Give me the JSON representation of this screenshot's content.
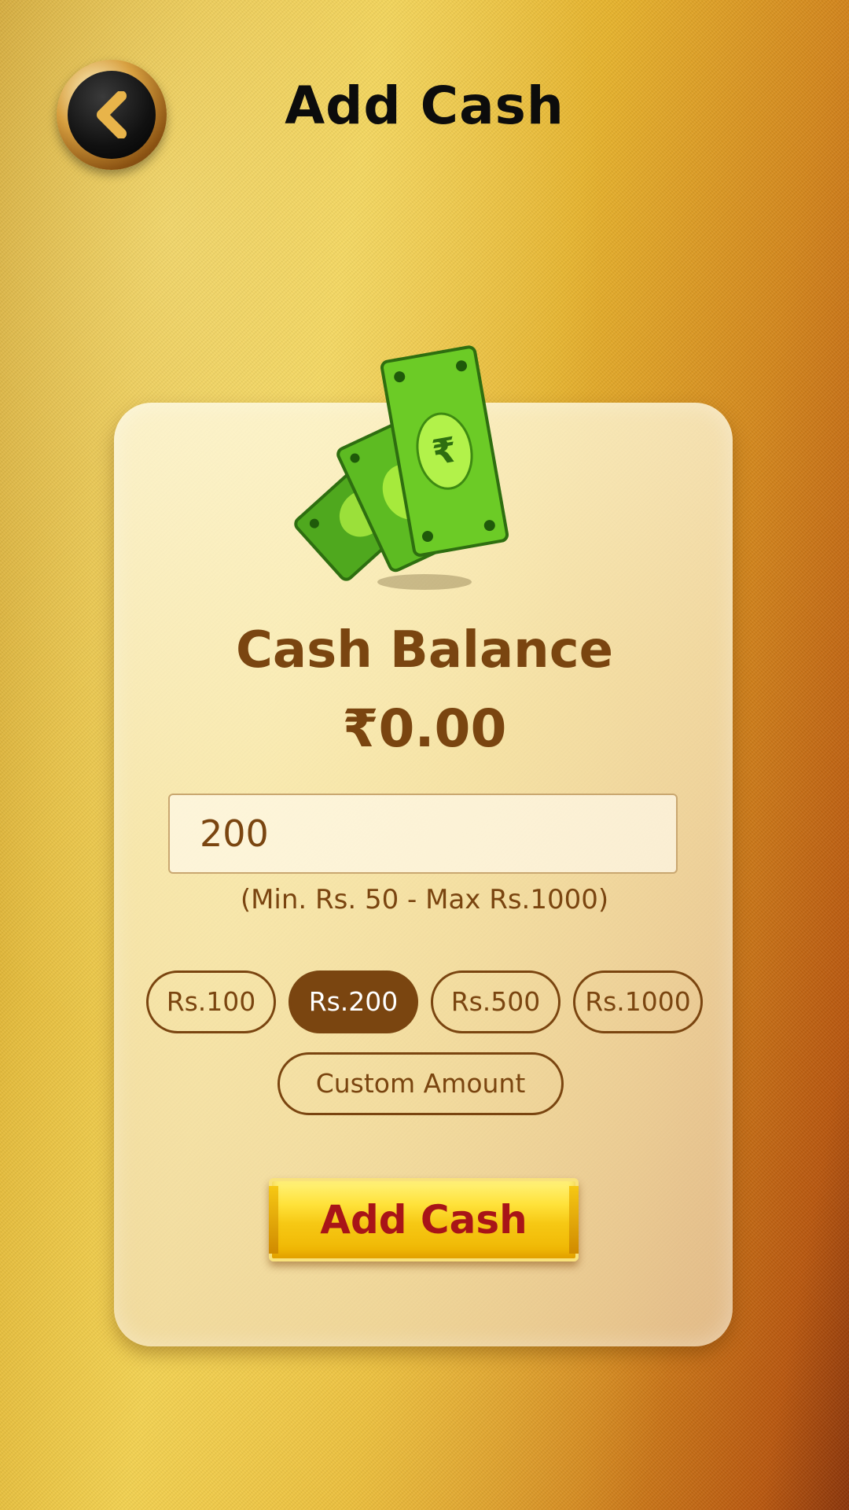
{
  "header": {
    "title": "Add Cash"
  },
  "balance": {
    "label": "Cash Balance",
    "value": "₹0.00"
  },
  "amount_input": {
    "value": "200",
    "placeholder": ""
  },
  "range_hint": "(Min. Rs. 50 - Max Rs.1000)",
  "chips": [
    {
      "label": "Rs.100",
      "selected": false
    },
    {
      "label": "Rs.200",
      "selected": true
    },
    {
      "label": "Rs.500",
      "selected": false
    },
    {
      "label": "Rs.1000",
      "selected": false
    },
    {
      "label": "Custom Amount",
      "selected": false
    }
  ],
  "add_button": {
    "label": "Add Cash"
  },
  "icons": {
    "back": "chevron-left-icon",
    "cash": "cash-notes-icon"
  },
  "colors": {
    "brand_brown": "#7a4510",
    "button_yellow": "#f6c814",
    "button_text": "#a81418"
  }
}
